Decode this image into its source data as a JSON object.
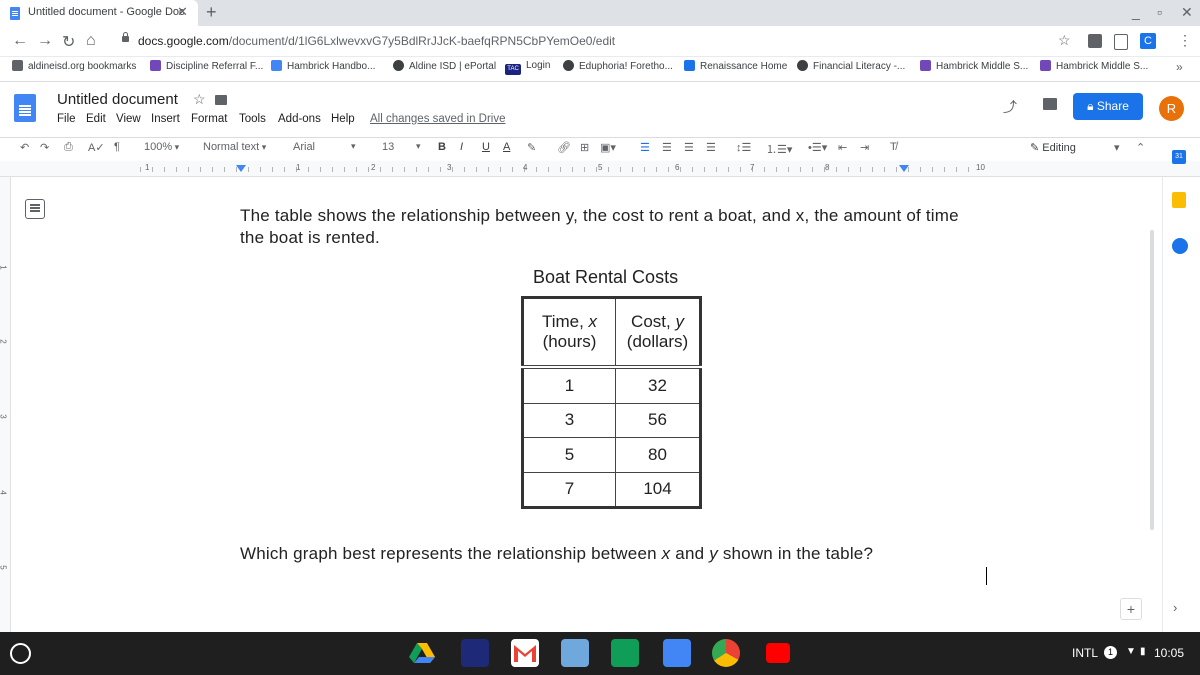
{
  "browser": {
    "tab_title": "Untitled document - Google Doc",
    "tab_close": "✕",
    "new_tab": "+",
    "url_host": "docs.google.com",
    "url_path": "/document/d/1lG6LxlwevxvG7y5BdlRrJJcK-baefqRPN5CbPYemOe0/edit"
  },
  "bookmarks": [
    {
      "label": "aldineisd.org bookmarks",
      "color": "#5f6368"
    },
    {
      "label": "Discipline Referral F...",
      "color": "#7248b9"
    },
    {
      "label": "Hambrick Handbo...",
      "color": "#4285f4"
    },
    {
      "label": "Aldine ISD | ePortal",
      "color": "#3c4043"
    },
    {
      "label": "Login",
      "color": "#1a237e"
    },
    {
      "label": "Eduphoria! Foretho...",
      "color": "#3c4043"
    },
    {
      "label": "Renaissance Home",
      "color": "#1a73e8"
    },
    {
      "label": "Financial Literacy -...",
      "color": "#3c4043"
    },
    {
      "label": "Hambrick Middle S...",
      "color": "#7248b9"
    },
    {
      "label": "Hambrick Middle S...",
      "color": "#7248b9"
    }
  ],
  "bookmark_badge": "TAC",
  "bookmarks_more": "»",
  "docs": {
    "title": "Untitled document",
    "menu": [
      "File",
      "Edit",
      "View",
      "Insert",
      "Format",
      "Tools",
      "Add-ons",
      "Help"
    ],
    "saved_status": "All changes saved in Drive",
    "share_label": "Share",
    "avatar_letter": "R"
  },
  "format_toolbar": {
    "zoom": "100%",
    "style": "Normal text",
    "font": "Arial",
    "size": "13",
    "bold": "B",
    "italic": "I",
    "underline": "U",
    "text_color": "A",
    "mode": "Editing"
  },
  "ruler_numbers": [
    "1",
    "1",
    "2",
    "3",
    "4",
    "5",
    "6",
    "7",
    "8",
    "10"
  ],
  "vruler_numbers": [
    "1",
    "2",
    "3",
    "4",
    "5"
  ],
  "side_panel": {
    "calendar_day": "31"
  },
  "content": {
    "question": "The table shows the relationship between y, the cost to rent a boat, and x, the amount of time the boat is rented.",
    "table_title": "Boat Rental Costs",
    "columns": [
      {
        "line1_label": "Time, ",
        "line1_var": "x",
        "line2": "(hours)"
      },
      {
        "line1_label": "Cost, ",
        "line1_var": "y",
        "line2": "(dollars)"
      }
    ],
    "rows": [
      [
        "1",
        "32"
      ],
      [
        "3",
        "56"
      ],
      [
        "5",
        "80"
      ],
      [
        "7",
        "104"
      ]
    ],
    "question2_a": "Which graph best represents the relationship between ",
    "question2_x": "x",
    "question2_b": " and ",
    "question2_y": "y",
    "question2_c": " shown in the table?"
  },
  "shelf": {
    "ime": "INTL",
    "notification_count": "1",
    "time": "10:05"
  }
}
